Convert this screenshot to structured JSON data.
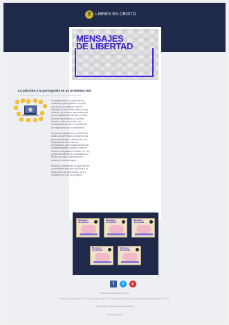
{
  "brand": {
    "logo_mark": "Y",
    "logo_text": "LIBRES EN CRISTO"
  },
  "hero": {
    "title": "MENSAJES\nDE LIBERTAD"
  },
  "article": {
    "headline": "La adicción a la pornografía es un problema real",
    "paragraphs": [
      "La observación y producción de materiales pornográficos, al igual que el uso y consumo, van en aumento en los últimos años; estos mismos, de manera más acelerada con la llegada del internet, es decir ya tiene la población un acceso directo a este contenido y es considerado uno de los problemas de mayor peso en la actualidad.",
      "Se puede categorizar en diferentes casos una del mismo problema; las personas tienden a desarrollar una dependencia de consumo pornográfico que implica consumirlo constantemente, sumado a esto el acceso a dispositivos móviles, el uso y dependencia de la computadora a fin de ver estos contenidos sin mesura o control alguno.",
      "Estamos conscientes de que esto es un problema real que nos lleva a la destrucción de las familias, de los matrimonios y de los hogares."
    ]
  },
  "gallery": {
    "items": [
      {
        "title": "Mensajes\nde libertad"
      },
      {
        "title": "Mensajes\nde libertad"
      },
      {
        "title": "Mensajes\nde libertad"
      },
      {
        "title": "Mensajes\nde libertad"
      },
      {
        "title": "Mensajes\nde libertad"
      }
    ]
  },
  "social": {
    "facebook": "f",
    "twitter": "t",
    "pinterest": "p"
  },
  "footer": {
    "line1": "Visita nuestra web libresencristo.org",
    "line2": "Recibes este correo porque te suscribiste a nuestro boletín. Si no deseas recibir más correos puedes darte de baja en cualquier momento.",
    "line3": "Libres en Cristo, todos los derechos reservados.",
    "unsubscribe": "Cancelar suscripción"
  },
  "colors": {
    "navy": "#1f2a4b",
    "accent_violet": "#3a22c7",
    "gold": "#c9b232"
  }
}
